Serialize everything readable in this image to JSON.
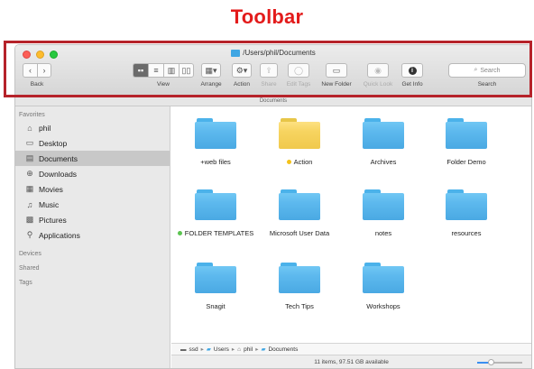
{
  "caption": "Toolbar",
  "window": {
    "title": "/Users/phil/Documents",
    "pathbar_label": "Documents"
  },
  "toolbar": {
    "back": {
      "label": "Back",
      "icons": [
        "chevron-left-icon",
        "chevron-right-icon"
      ]
    },
    "view": {
      "label": "View",
      "modes": [
        "icon-view",
        "list-view",
        "column-view",
        "cover-flow-view"
      ],
      "active": 0
    },
    "arrange": {
      "label": "Arrange"
    },
    "action": {
      "label": "Action"
    },
    "share": {
      "label": "Share",
      "enabled": false
    },
    "edit_tags": {
      "label": "Edit Tags",
      "enabled": false
    },
    "new_folder": {
      "label": "New Folder"
    },
    "quick_look": {
      "label": "Quick Look",
      "enabled": false
    },
    "get_info": {
      "label": "Get Info"
    },
    "search": {
      "placeholder": "Search",
      "label": "Search"
    }
  },
  "sidebar": {
    "favorites_header": "Favorites",
    "favorites": [
      {
        "label": "phil",
        "icon": "home-icon"
      },
      {
        "label": "Desktop",
        "icon": "desktop-icon"
      },
      {
        "label": "Documents",
        "icon": "documents-icon",
        "selected": true
      },
      {
        "label": "Downloads",
        "icon": "downloads-icon"
      },
      {
        "label": "Movies",
        "icon": "movies-icon"
      },
      {
        "label": "Music",
        "icon": "music-icon"
      },
      {
        "label": "Pictures",
        "icon": "pictures-icon"
      },
      {
        "label": "Applications",
        "icon": "applications-icon"
      }
    ],
    "devices_header": "Devices",
    "shared_header": "Shared",
    "tags_header": "Tags"
  },
  "files": [
    {
      "name": "+web files",
      "color": "blue",
      "tag": null
    },
    {
      "name": "Action",
      "color": "yellow",
      "tag": "#f4c21b"
    },
    {
      "name": "Archives",
      "color": "blue",
      "tag": null
    },
    {
      "name": "Folder Demo",
      "color": "blue",
      "tag": null
    },
    {
      "name": "FOLDER TEMPLATES",
      "color": "blue",
      "tag": "#5cc451"
    },
    {
      "name": "Microsoft User Data",
      "color": "blue",
      "tag": null
    },
    {
      "name": "notes",
      "color": "blue",
      "tag": null
    },
    {
      "name": "resources",
      "color": "blue",
      "tag": null
    },
    {
      "name": "Snagit",
      "color": "blue",
      "tag": null
    },
    {
      "name": "Tech Tips",
      "color": "blue",
      "tag": null
    },
    {
      "name": "Workshops",
      "color": "blue",
      "tag": null
    }
  ],
  "path": {
    "crumbs": [
      "ssd",
      "Users",
      "phil",
      "Documents"
    ]
  },
  "status": {
    "text": "11 items, 97.51 GB available",
    "icon_size_level": 0.3
  }
}
